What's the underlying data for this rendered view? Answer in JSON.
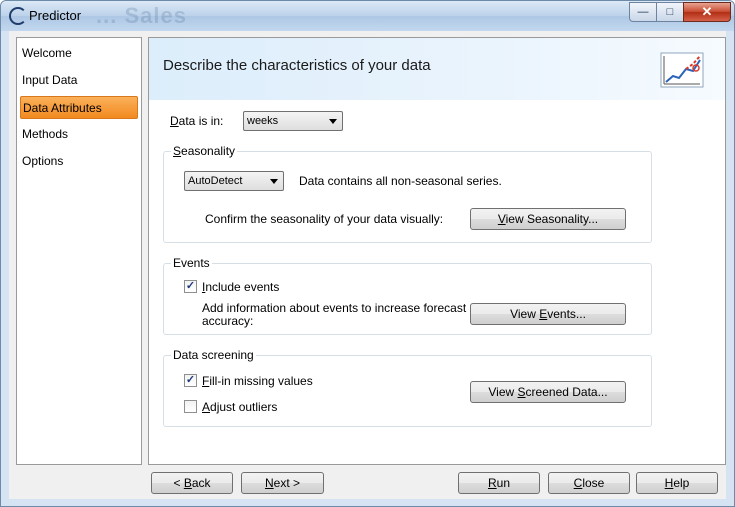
{
  "window": {
    "title": "Predictor",
    "ghost_title": "... Sales",
    "minimize": "—",
    "maximize": "□",
    "close": "✕"
  },
  "sidebar": {
    "items": [
      {
        "label": "Welcome",
        "active": false
      },
      {
        "label": "Input Data",
        "active": false
      },
      {
        "label": "Data Attributes",
        "active": true
      },
      {
        "label": "Methods",
        "active": false
      },
      {
        "label": "Options",
        "active": false
      }
    ]
  },
  "main": {
    "title": "Describe the characteristics of your data",
    "icon": "chart-line-icon",
    "data_in": {
      "label_prefix": "D",
      "label_rest": "ata is in:",
      "value": "weeks"
    },
    "seasonality": {
      "title_prefix": "S",
      "title_rest": "easonality",
      "select_value": "AutoDetect",
      "status": "Data contains all non-seasonal series.",
      "confirm_text": "Confirm the seasonality of your data visually:",
      "button_prefix": "V",
      "button_rest": "iew Seasonality..."
    },
    "events": {
      "title": "Events",
      "checkbox_prefix": "I",
      "checkbox_rest": "nclude events",
      "checked": true,
      "info_line1": "Add information about events to increase forecast",
      "info_line2": "accuracy:",
      "button_pre": "View ",
      "button_u": "E",
      "button_post": "vents..."
    },
    "screening": {
      "title": "Data screening",
      "fill_prefix": "F",
      "fill_rest": "ill-in missing values",
      "fill_checked": true,
      "adjust_prefix": "A",
      "adjust_rest": "djust outliers",
      "adjust_checked": false,
      "button_pre": "View ",
      "button_u": "S",
      "button_post": "creened Data..."
    }
  },
  "footer": {
    "back": {
      "pre": "< ",
      "u": "B",
      "post": "ack"
    },
    "next": {
      "pre": "",
      "u": "N",
      "post": "ext >"
    },
    "run": {
      "pre": "",
      "u": "R",
      "post": "un"
    },
    "close": {
      "pre": "",
      "u": "C",
      "post": "lose"
    },
    "help": {
      "pre": "",
      "u": "H",
      "post": "elp"
    }
  },
  "colors": {
    "accent": "#f28a20",
    "header_blue": "#dcedfb"
  }
}
